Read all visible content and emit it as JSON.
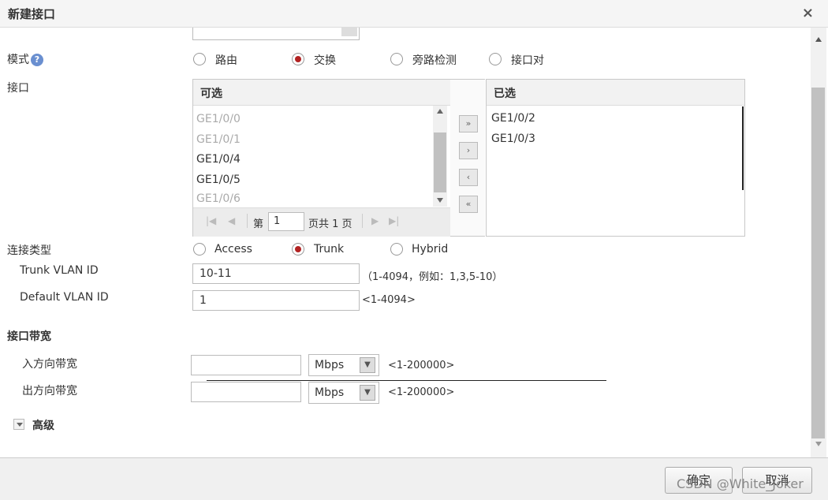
{
  "dialog": {
    "title": "新建接口",
    "close_glyph": "×"
  },
  "mode": {
    "label": "模式",
    "help_glyph": "?",
    "options": [
      "路由",
      "交换",
      "旁路检测",
      "接口对"
    ],
    "selected": "交换"
  },
  "interface": {
    "label": "接口",
    "available": {
      "header": "可选",
      "items": [
        {
          "name": "GE1/0/0",
          "enabled": false
        },
        {
          "name": "GE1/0/1",
          "enabled": false
        },
        {
          "name": "GE1/0/4",
          "enabled": true
        },
        {
          "name": "GE1/0/5",
          "enabled": true
        },
        {
          "name": "GE1/0/6",
          "enabled": false
        }
      ],
      "pager": {
        "prefix": "第",
        "page": "1",
        "suffix": "页共 1 页"
      }
    },
    "selected_list": {
      "header": "已选",
      "items": [
        "GE1/0/2",
        "GE1/0/3"
      ]
    },
    "transfer_buttons": [
      "»",
      "›",
      "‹",
      "«"
    ]
  },
  "link_type": {
    "label": "连接类型",
    "options": [
      "Access",
      "Trunk",
      "Hybrid"
    ],
    "selected": "Trunk"
  },
  "trunk_vlan": {
    "label": "Trunk VLAN ID",
    "value": "10-11",
    "hint": "（1-4094，例如：1,3,5-10）"
  },
  "default_vlan": {
    "label": "Default VLAN ID",
    "value": "1",
    "hint": "<1-4094>"
  },
  "bandwidth": {
    "section_title": "接口带宽",
    "inbound": {
      "label": "入方向带宽",
      "value": "",
      "unit": "Mbps",
      "hint": "<1-200000>"
    },
    "outbound": {
      "label": "出方向带宽",
      "value": "",
      "unit": "Mbps",
      "hint": "<1-200000>"
    }
  },
  "advanced": {
    "label": "高级"
  },
  "footer": {
    "ok": "确定",
    "cancel": "取消",
    "watermark": "CSDN @White_Joker"
  }
}
